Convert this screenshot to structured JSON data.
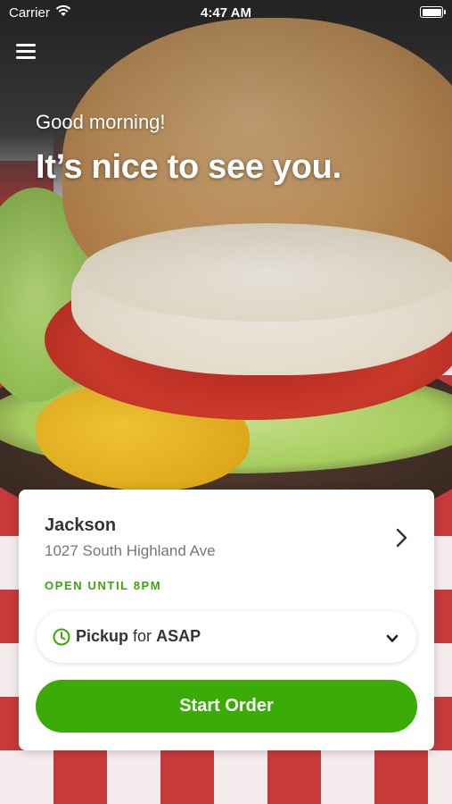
{
  "status_bar": {
    "carrier": "Carrier",
    "time": "4:47 AM",
    "wifi_icon": "wifi-icon",
    "battery_icon": "battery-icon"
  },
  "header": {
    "menu_icon": "hamburger-menu-icon",
    "greeting": "Good morning!",
    "headline": "It’s nice to see you."
  },
  "location_card": {
    "name": "Jackson",
    "address": "1027 South Highland Ave",
    "hours": "OPEN UNTIL 8PM",
    "chevron_icon": "chevron-right-icon",
    "order_type": {
      "clock_icon": "clock-icon",
      "mode": "Pickup",
      "connector": "for",
      "time": "ASAP",
      "chevron_icon": "chevron-down-icon"
    },
    "start_button": "Start Order"
  },
  "colors": {
    "accent_green": "#3aab07",
    "hours_green": "#3aa808",
    "text_dark": "#333333",
    "text_muted": "#777777"
  }
}
